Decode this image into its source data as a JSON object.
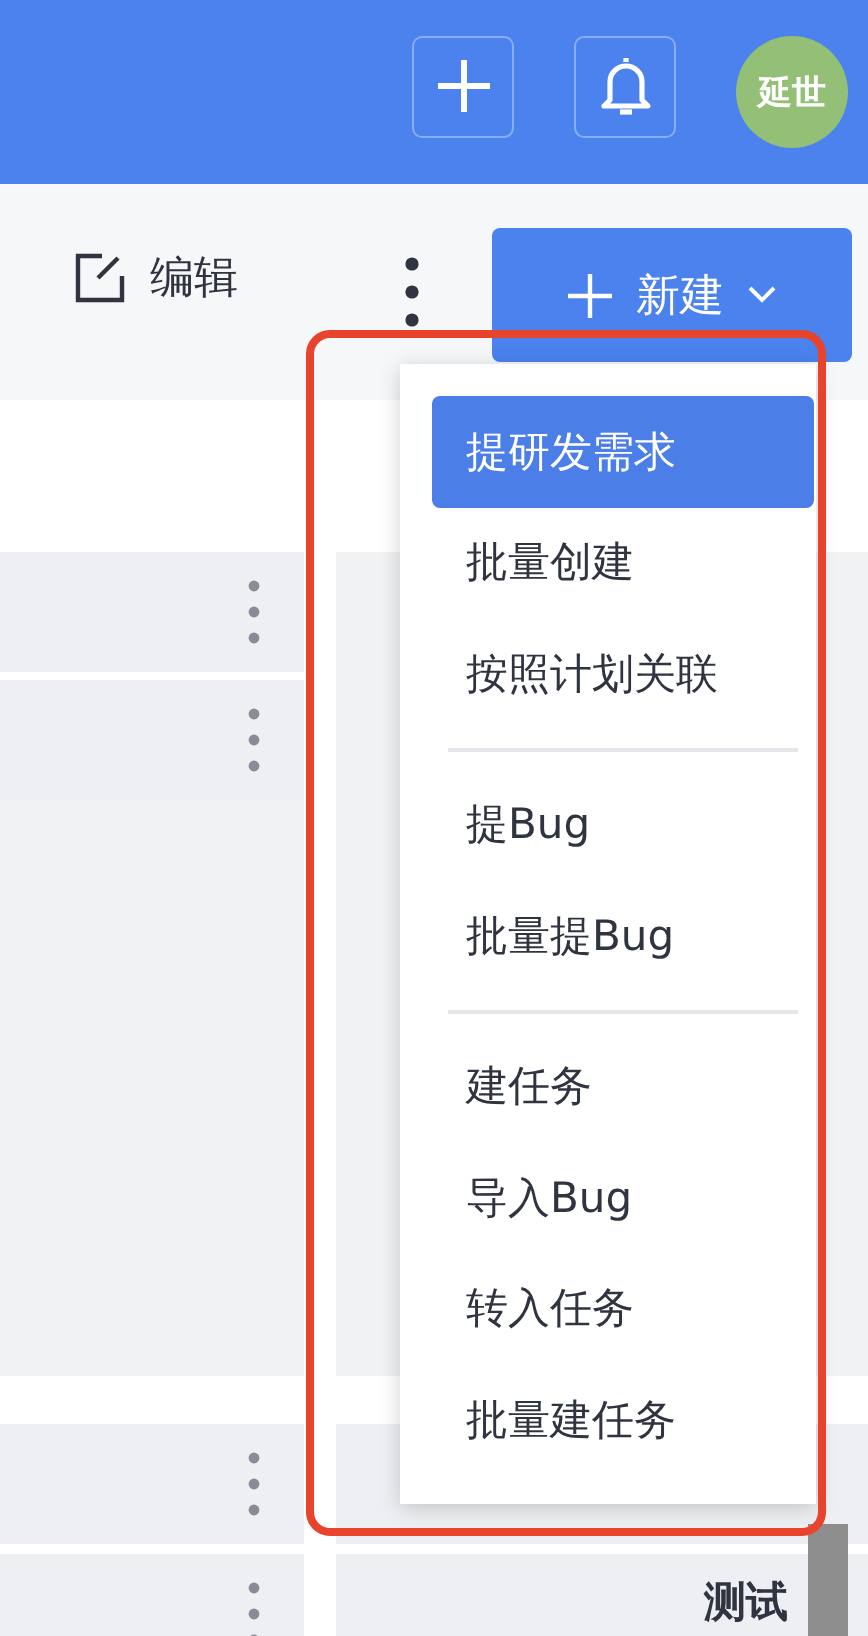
{
  "header": {
    "avatar": "延世"
  },
  "toolbar": {
    "edit": "编辑",
    "new_button": "新建"
  },
  "content": {
    "right_card_title": "测试"
  },
  "menu": {
    "groups": [
      {
        "items": [
          {
            "label": "提研发需求",
            "selected": true
          },
          {
            "label": "批量创建",
            "selected": false
          },
          {
            "label": "按照计划关联",
            "selected": false
          }
        ]
      },
      {
        "items": [
          {
            "label": "提Bug",
            "selected": false
          },
          {
            "label": "批量提Bug",
            "selected": false
          }
        ]
      },
      {
        "items": [
          {
            "label": "建任务",
            "selected": false
          },
          {
            "label": "导入Bug",
            "selected": false
          },
          {
            "label": "转入任务",
            "selected": false
          },
          {
            "label": "批量建任务",
            "selected": false
          }
        ]
      }
    ]
  }
}
